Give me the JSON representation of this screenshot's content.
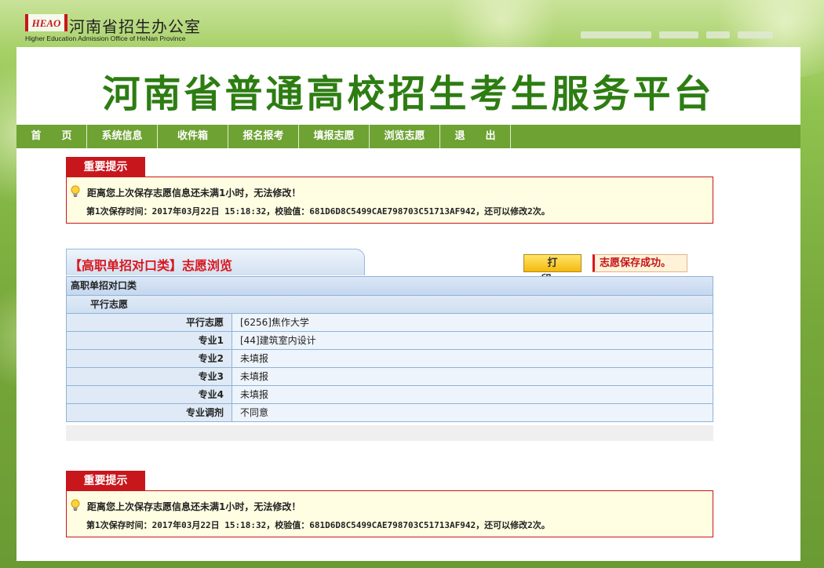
{
  "header": {
    "logo_mark": "HEAO",
    "org_name_cn": "河南省招生办公室",
    "org_name_en": "Higher Education Admission Office of HeNan Province"
  },
  "banner": {
    "title": "河南省普通高校招生考生服务平台"
  },
  "nav": {
    "items": [
      {
        "label": "首　　页"
      },
      {
        "label": "系统信息"
      },
      {
        "label": "收件箱"
      },
      {
        "label": "报名报考"
      },
      {
        "label": "填报志愿"
      },
      {
        "label": "浏览志愿"
      },
      {
        "label": "退　　出"
      }
    ]
  },
  "notice_top": {
    "tab": "重要提示",
    "line1": "距离您上次保存志愿信息还未满1小时，无法修改！",
    "line2": "第1次保存时间：2017年03月22日 15:18:32，校验值：681D6D8C5499CAE798703C51713AF942，还可以修改2次。"
  },
  "section": {
    "title": "【高职单招对口类】志愿浏览",
    "print_label": "打印",
    "success_msg": "志愿保存成功。"
  },
  "table": {
    "category": "高职单招对口类",
    "group": "平行志愿",
    "rows": [
      {
        "label": "平行志愿",
        "value": "[6256]焦作大学"
      },
      {
        "label": "专业1",
        "value": "[44]建筑室内设计"
      },
      {
        "label": "专业2",
        "value": "未填报"
      },
      {
        "label": "专业3",
        "value": "未填报"
      },
      {
        "label": "专业4",
        "value": "未填报"
      },
      {
        "label": "专业调剂",
        "value": "不同意"
      }
    ]
  },
  "notice_bottom": {
    "tab": "重要提示",
    "line1": "距离您上次保存志愿信息还未满1小时，无法修改！",
    "line2": "第1次保存时间：2017年03月22日 15:18:32，校验值：681D6D8C5499CAE798703C51713AF942，还可以修改2次。"
  },
  "colors": {
    "brand_green": "#2d7d12",
    "nav_green": "#6ea233",
    "alert_red": "#c8161d",
    "table_border": "#8fb2d8"
  }
}
